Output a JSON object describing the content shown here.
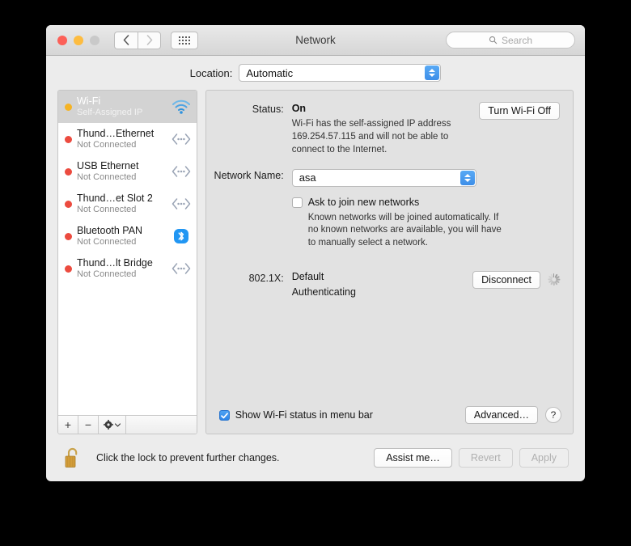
{
  "window": {
    "title": "Network",
    "traffic_lights": [
      "close",
      "minimize",
      "zoom"
    ],
    "nav_back_icon": "chevron-left-icon",
    "nav_forward_icon": "chevron-right-icon",
    "grid_icon": "grid-view-icon",
    "search": {
      "placeholder": "Search",
      "value": "",
      "icon": "search-icon"
    }
  },
  "location": {
    "label": "Location:",
    "value": "Automatic"
  },
  "sidebar": {
    "services": [
      {
        "name": "Wi-Fi",
        "status": "Self-Assigned IP",
        "dot": "#f5b324",
        "icon": "wifi-icon",
        "selected": true
      },
      {
        "name": "Thund…Ethernet",
        "status": "Not Connected",
        "dot": "#ec4b3f",
        "icon": "ethernet-icon",
        "selected": false
      },
      {
        "name": "USB Ethernet",
        "status": "Not Connected",
        "dot": "#ec4b3f",
        "icon": "ethernet-icon",
        "selected": false
      },
      {
        "name": "Thund…et Slot 2",
        "status": "Not Connected",
        "dot": "#ec4b3f",
        "icon": "ethernet-icon",
        "selected": false
      },
      {
        "name": "Bluetooth PAN",
        "status": "Not Connected",
        "dot": "#ec4b3f",
        "icon": "bluetooth-icon",
        "selected": false
      },
      {
        "name": "Thund…lt Bridge",
        "status": "Not Connected",
        "dot": "#ec4b3f",
        "icon": "ethernet-icon",
        "selected": false
      }
    ],
    "footer": {
      "add": "+",
      "remove": "−",
      "gear_icon": "gear-icon",
      "gear_chevron": "chevron-down-icon"
    }
  },
  "panel": {
    "status": {
      "label": "Status:",
      "value": "On",
      "button": "Turn Wi-Fi Off",
      "description": "Wi-Fi has the self-assigned IP address 169.254.57.115 and will not be able to connect to the Internet."
    },
    "network_name": {
      "label": "Network Name:",
      "value": "asa"
    },
    "ask_to_join": {
      "label": "Ask to join new networks",
      "checked": false,
      "note": "Known networks will be joined automatically. If no known networks are available, you will have to manually select a network."
    },
    "dot1x": {
      "label": "802.1X:",
      "value": "Default",
      "sub": "Authenticating",
      "button": "Disconnect",
      "spinner_icon": "loading-spinner-icon"
    },
    "show_status": {
      "label": "Show Wi-Fi status in menu bar",
      "checked": true
    },
    "advanced_button": "Advanced…",
    "help_button": "?"
  },
  "footer": {
    "lock_icon": "unlocked-padlock-icon",
    "lock_text": "Click the lock to prevent further changes.",
    "assist_button": "Assist me…",
    "revert_button": "Revert",
    "apply_button": "Apply",
    "revert_disabled": true,
    "apply_disabled": true
  },
  "colors": {
    "accent_blue": "#3d8ee8",
    "status_orange": "#f5b324",
    "status_red": "#ec4b3f",
    "bluetooth_blue": "#2196f3"
  }
}
